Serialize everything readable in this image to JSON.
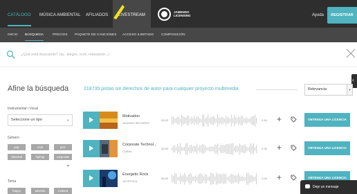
{
  "topnav": {
    "tabs": [
      {
        "label": "CATÁLOGO"
      },
      {
        "label": "MÚSICA AMBIENTAL"
      },
      {
        "label": "AFILIADOS"
      },
      {
        "label": "LIVESTREAM"
      }
    ],
    "logo_text_1": "JAMENDO",
    "logo_text_2": "LICENSING",
    "help": "Ayuda",
    "register": "REGISTRAR"
  },
  "subnav": {
    "items": [
      {
        "label": "INICIO"
      },
      {
        "label": "BÚSQUEDA"
      },
      {
        "label": "PRECIOS"
      },
      {
        "label": "PAQUETE DE CANCIONES"
      },
      {
        "label": "ACCESO ILIMITADO"
      },
      {
        "label": "COMPOSICIÓN"
      }
    ]
  },
  "search": {
    "placeholder": "¿Qué está buscando? (ej.: alegre, rock, relaxation...)"
  },
  "refine": {
    "title": "Afine la búsqueda",
    "instrumental_label": "Instrumental / Vocal",
    "instrumental_value": "Seleccione un tipo",
    "genre_label": "Género",
    "genre_chips": [
      "pop",
      "rock",
      "jazz",
      "classical",
      "hiphop",
      "corporate"
    ],
    "theme_label": "Tema",
    "theme_chips": [
      "happy",
      "advertis",
      "motivat"
    ]
  },
  "results": {
    "title": "218735 pistas sin derechos de autor para cualquier proyecto multimedia",
    "sort_value": "Relevancia"
  },
  "tracks": [
    {
      "name": "Motivation",
      "artist": "AKASHIC RECORDS",
      "start": "00:00",
      "duration": "3:16",
      "license": "OBTENGA UNA LICENCIA"
    },
    {
      "name": "Corporate Technol...",
      "artist": "CUSHC",
      "start": "00:00",
      "duration": "2:35",
      "license": "OBTENGA UNA LICENCIA"
    },
    {
      "name": "Energetic Rock",
      "artist": "JOYSTOCK",
      "start": "00:00",
      "duration": "2:26",
      "license": "OBTENGA UNA LICENCIA"
    }
  ],
  "chat": {
    "label": "Deje un mensaje"
  },
  "colors": {
    "accent": "#4fb3c0",
    "nav_dark": "#2e2e2e",
    "subnav": "#474747",
    "chip": "#a8a8a8"
  }
}
